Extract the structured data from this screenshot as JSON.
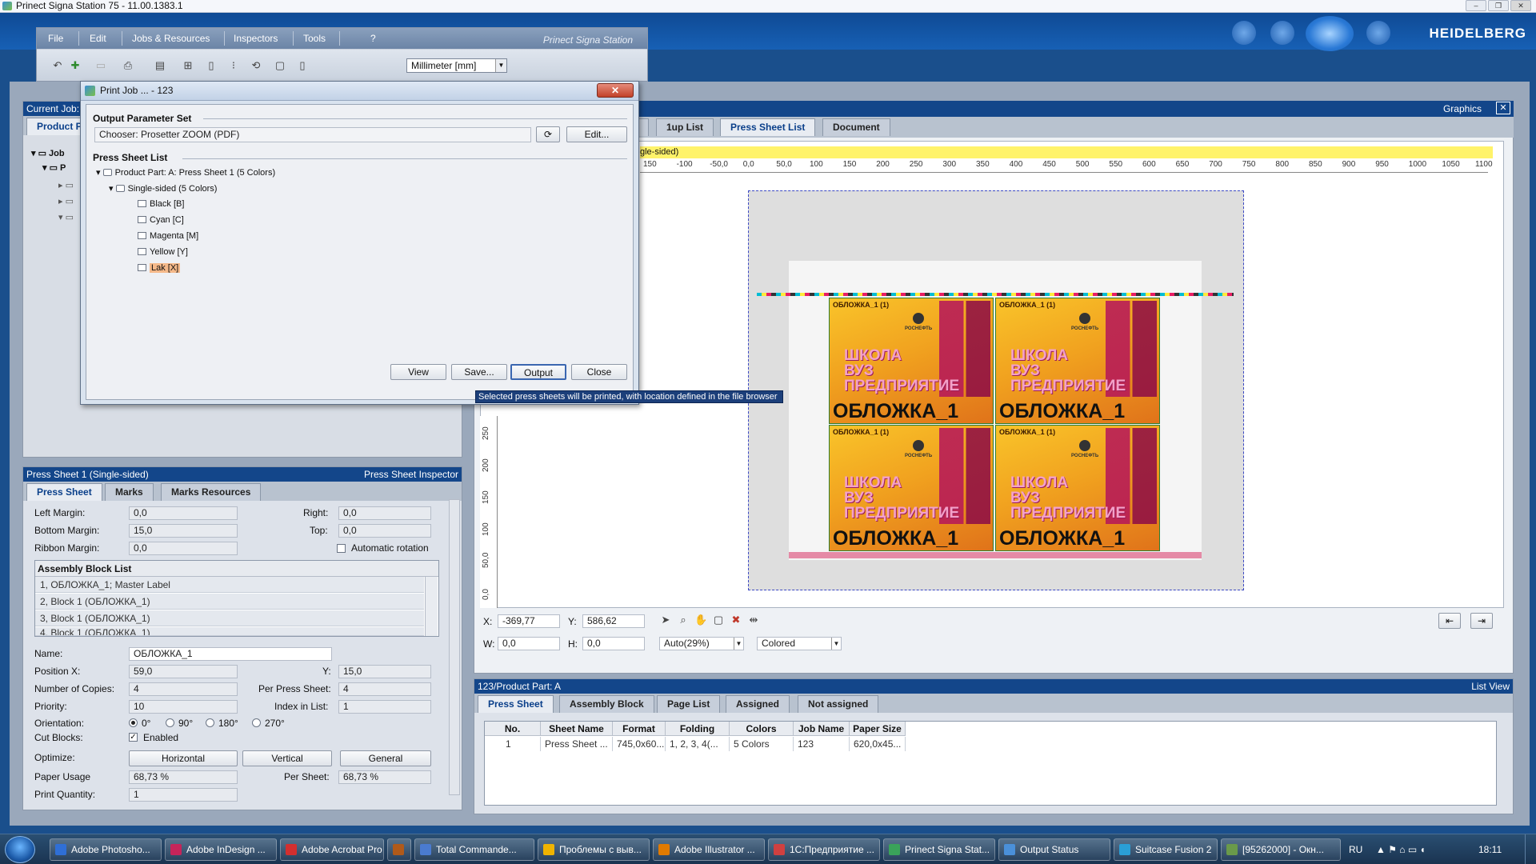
{
  "os_title": "Prinect Signa Station 75  -  11.00.1383.1",
  "brand": "HEIDELBERG",
  "menu": {
    "items": [
      "File",
      "Edit",
      "Jobs & Resources",
      "Inspectors",
      "Tools",
      "?"
    ],
    "product_title": "Prinect Signa Station"
  },
  "toolbar": {
    "unit": "Millimeter  [mm]"
  },
  "left_top": {
    "header": "Current Job: ",
    "tab_label": "Product P",
    "tree": [
      "Job",
      "P"
    ]
  },
  "inspector": {
    "header_left": "Press Sheet 1 (Single-sided)",
    "header_right": "Press Sheet Inspector",
    "tabs": [
      "Press Sheet",
      "Marks",
      "Marks Resources"
    ],
    "left_margin_label": "Left Margin:",
    "left_margin": "0,0",
    "right_label": "Right:",
    "right": "0,0",
    "bottom_margin_label": "Bottom Margin:",
    "bottom_margin": "15,0",
    "top_label": "Top:",
    "top": "0,0",
    "ribbon_margin_label": "Ribbon Margin:",
    "ribbon_margin": "0,0",
    "auto_rotation": "Automatic rotation",
    "assembly_header": "Assembly Block List",
    "assembly_rows": [
      "1, ОБЛОЖКА_1; Master Label",
      "2, Block 1 (ОБЛОЖКА_1)",
      "3, Block 1 (ОБЛОЖКА_1)",
      "4, Block 1 (ОБЛОЖКА_1)"
    ],
    "name_label": "Name:",
    "name": "ОБЛОЖКА_1",
    "posx_label": "Position X:",
    "posx": "59,0",
    "y_label": "Y:",
    "y": "15,0",
    "copies_label": "Number of Copies:",
    "copies": "4",
    "per_sheet_label": "Per Press Sheet:",
    "per_sheet": "4",
    "priority_label": "Priority:",
    "priority": "10",
    "index_label": "Index in List:",
    "index": "1",
    "orientation_label": "Orientation:",
    "orientations": [
      "0°",
      "90°",
      "180°",
      "270°"
    ],
    "cut_label": "Cut Blocks:",
    "cut_enabled": "Enabled",
    "optimize_label": "Optimize:",
    "optimize_buttons": [
      "Horizontal",
      "Vertical",
      "General"
    ],
    "usage_label": "Paper Usage",
    "usage": "68,73 %",
    "per_sheet2_label": "Per Sheet:",
    "per_sheet2": "68,73 %",
    "print_qty_label": "Print Quantity:",
    "print_qty": "1"
  },
  "graphics": {
    "header": "Graphics",
    "tabs": [
      "k",
      "1up List",
      "Press Sheet List",
      "Document"
    ],
    "yellow_text": "gle-sided)",
    "ruler_top": [
      "150",
      "-100",
      "-50,0",
      "0,0",
      "50,0",
      "100",
      "150",
      "200",
      "250",
      "300",
      "350",
      "400",
      "450",
      "500",
      "550",
      "600",
      "650",
      "700",
      "750",
      "800",
      "850",
      "900",
      "950",
      "1000",
      "1050",
      "1100"
    ],
    "ruler_left": [
      "250",
      "200",
      "150",
      "100",
      "50,0",
      "0,0"
    ],
    "covers": [
      {
        "title": "ОБЛОЖКА_1 (1)",
        "mid": "ШКОЛА\nВУЗ\nПРЕДПРИЯТИЕ",
        "big": "ОБЛОЖКА_1",
        "logo": "РОСНЕФТЬ"
      },
      {
        "title": "ОБЛОЖКА_1 (1)",
        "mid": "ШКОЛА\nВУЗ\nПРЕДПРИЯТИЕ",
        "big": "ОБЛОЖКА_1",
        "logo": "РОСНЕФТЬ"
      },
      {
        "title": "ОБЛОЖКА_1 (1)",
        "mid": "ШКОЛА\nВУЗ\nПРЕДПРИЯТИЕ",
        "big": "ОБЛОЖКА_1",
        "logo": "РОСНЕФТЬ"
      },
      {
        "title": "ОБЛОЖКА_1 (1)",
        "mid": "ШКОЛА\nВУЗ\nПРЕДПРИЯТИЕ",
        "big": "ОБЛОЖКА_1",
        "logo": "РОСНЕФТЬ"
      }
    ],
    "coord": {
      "x_label": "X:",
      "x": "-369,77",
      "y_label": "Y:",
      "y": "586,62",
      "w_label": "W:",
      "w": "0,0",
      "h_label": "H:",
      "h": "0,0",
      "zoom": "Auto(29%)",
      "color_mode": "Colored"
    }
  },
  "listview": {
    "header_left": "123/Product Part: A",
    "header_right": "List View",
    "tabs": [
      "Press Sheet",
      "Assembly Block",
      "Page List",
      "Assigned",
      "Not assigned"
    ],
    "columns": [
      "No.",
      "Sheet Name",
      "Format",
      "Folding Sheet",
      "Colors",
      "Job Name",
      "Paper Size"
    ],
    "rows": [
      [
        "1",
        "Press Sheet ...",
        "745,0x60...",
        "1, 2, 3, 4(...",
        "5 Colors",
        "123",
        "620,0x45..."
      ]
    ]
  },
  "dialog": {
    "title": "Print Job ... - 123",
    "close": "✕",
    "output_param_label": "Output Parameter Set",
    "chooser": "Chooser: Prosetter ZOOM (PDF)",
    "edit": "Edit...",
    "sheet_list_label": "Press Sheet List",
    "tree": {
      "part": "Product Part: A: Press Sheet 1 (5 Colors)",
      "side": "Single-sided (5 Colors)",
      "colors": [
        "Black  [B]",
        "Cyan  [C]",
        "Magenta  [M]",
        "Yellow  [Y]",
        "Lak  [X]"
      ]
    },
    "buttons": [
      "View",
      "Save...",
      "Output",
      "Close"
    ],
    "tooltip": "Selected press sheets will be printed, with location defined in the file browser"
  },
  "taskbar": {
    "tasks": [
      "Adobe Photosho...",
      "Adobe InDesign ...",
      "Adobe Acrobat Pro",
      "",
      "Total Commande...",
      "Проблемы с выв...",
      "Adobe Illustrator ...",
      "1С:Предприятие ...",
      "Prinect Signa Stat...",
      "Output Status",
      "Suitcase Fusion 2",
      "[95262000] - Окн..."
    ],
    "lang": "RU",
    "clock": "18:11"
  }
}
